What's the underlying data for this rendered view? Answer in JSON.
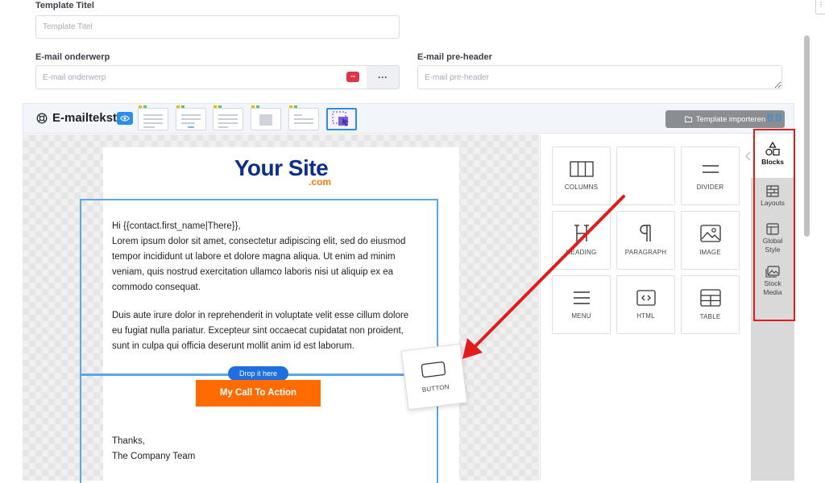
{
  "form": {
    "title_label": "Template Titel",
    "title_placeholder": "Template Titel",
    "subject_label": "E-mail onderwerp",
    "subject_placeholder": "E-mail onderwerp",
    "subject_more": "···",
    "preheader_label": "E-mail pre-header",
    "preheader_placeholder": "E-mail pre-header"
  },
  "toolbar": {
    "title": "E-mailtekst",
    "import_label": "Template importeren",
    "merge_label": "{{ }}"
  },
  "email": {
    "logo_main": "Your Site",
    "logo_sub": ".com",
    "greeting": "Hi {{contact.first_name|There}},",
    "paragraph1": "Lorem ipsum dolor sit amet, consectetur adipiscing elit, sed do eiusmod tempor incididunt ut labore et dolore magna aliqua. Ut enim ad minim veniam, quis nostrud exercitation ullamco laboris nisi ut aliquip ex ea commodo consequat.",
    "paragraph2": "Duis aute irure dolor in reprehenderit in voluptate velit esse cillum dolore eu fugiat nulla pariatur. Excepteur sint occaecat cupidatat non proident, sunt in culpa qui officia deserunt mollit anim id est laborum.",
    "drop_label": "Drop it here",
    "cta_label": "My Call To Action",
    "signoff1": "Thanks,",
    "signoff2": "The Company Team"
  },
  "blocks": {
    "columns": "COLUMNS",
    "divider": "DIVIDER",
    "heading": "HEADING",
    "paragraph": "PARAGRAPH",
    "image": "IMAGE",
    "menu": "MENU",
    "html": "HTML",
    "table": "TABLE",
    "dragging": "BUTTON"
  },
  "side_tabs": {
    "blocks": "Blocks",
    "layouts": "Layouts",
    "global_style": "Global Style",
    "stock_media": "Stock Media"
  },
  "colors": {
    "accent": "#2a8de9",
    "cta": "#ff6b00",
    "logo": "#0d2f8c",
    "annotation": "#e31b1b"
  }
}
